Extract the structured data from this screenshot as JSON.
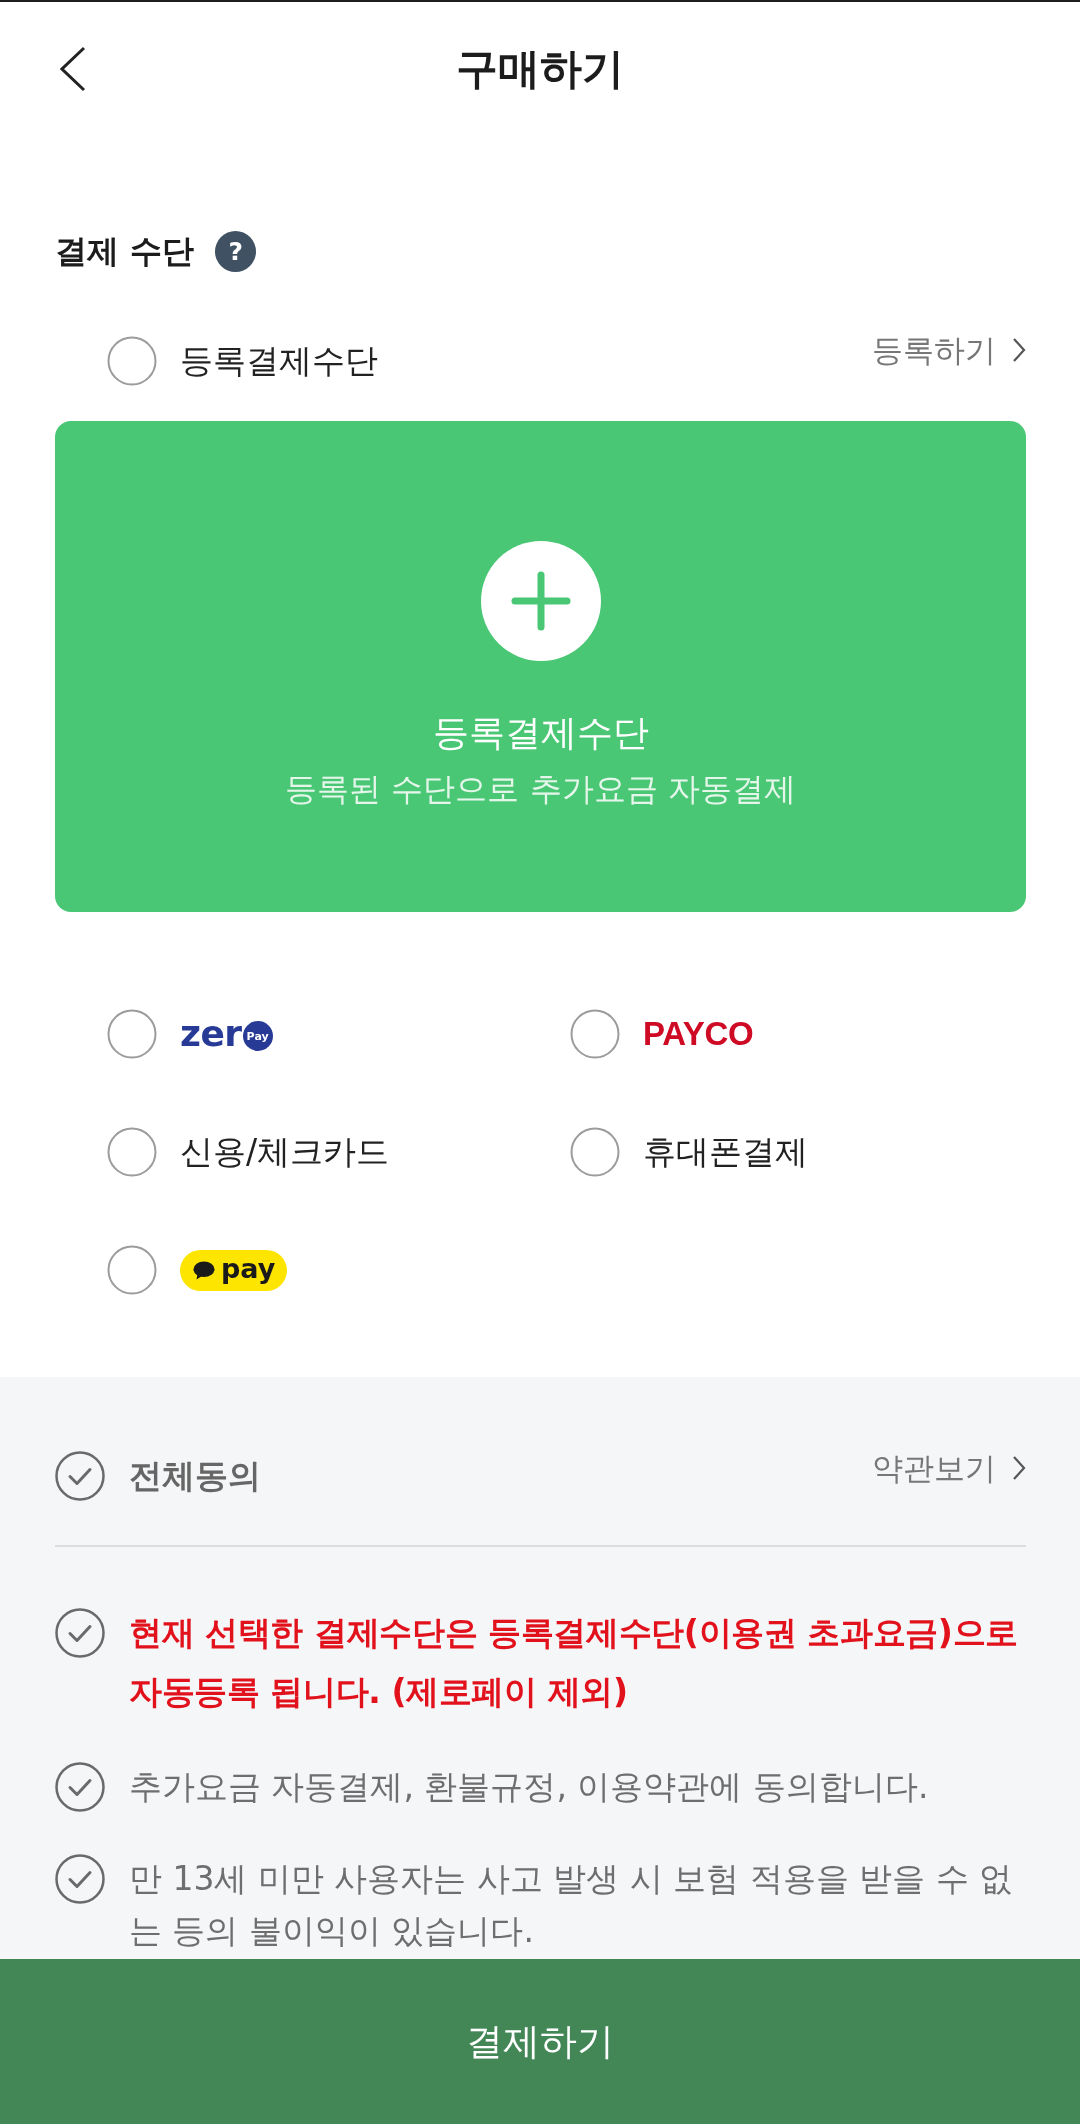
{
  "header": {
    "title": "구매하기"
  },
  "payment": {
    "title": "결제 수단",
    "help": "?",
    "registered": {
      "label": "등록결제수단",
      "selected": false,
      "link": "등록하기"
    },
    "card": {
      "title": "등록결제수단",
      "subtitle": "등록된 수단으로 추가요금 자동결제"
    },
    "options": [
      {
        "kind": "badge",
        "label": "zer",
        "badge": "Pay",
        "selected": false
      },
      {
        "kind": "wordmark",
        "label": "PAYCO",
        "selected": false
      },
      {
        "kind": "text",
        "label": "신용/체크카드",
        "selected": false
      },
      {
        "kind": "text",
        "label": "휴대폰결제",
        "selected": false
      },
      {
        "kind": "pill",
        "label": "pay",
        "selected": false
      }
    ]
  },
  "agreement": {
    "all": {
      "label": "전체동의",
      "checked": false,
      "link": "약관보기"
    },
    "items": [
      {
        "kind": "notice",
        "text": "현재 선택한 결제수단은 등록결제수단(이용권 초과요금)으로 자동등록 됩니다. (제로페이 제외)",
        "checked": false
      },
      {
        "kind": "term",
        "text": "추가요금 자동결제, 환불규정, 이용약관에 동의합니다.",
        "checked": false
      },
      {
        "kind": "term",
        "text": "만 13세 미만 사용자는 사고 발생 시 보험 적용을 받을 수 없는 등의 불이익이 있습니다.",
        "checked": false
      }
    ]
  },
  "submit": {
    "label": "결제하기"
  }
}
